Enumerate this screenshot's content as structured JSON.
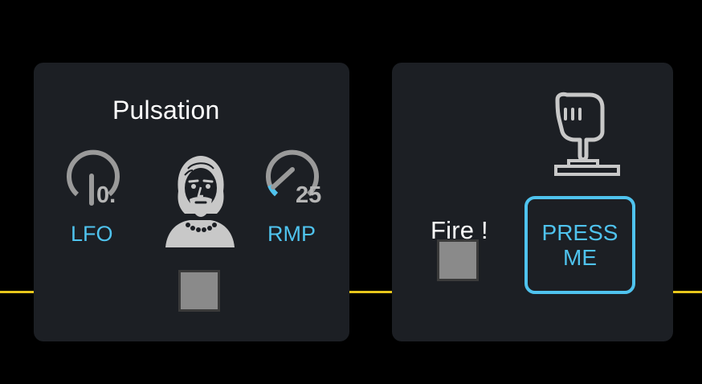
{
  "colors": {
    "background": "#000000",
    "panel": "#1c1f24",
    "accent": "#4fc3ee",
    "wire": "#e7c61b",
    "knob_track": "#9a9a9a",
    "toggle": "#8a8a8a"
  },
  "pulsation": {
    "title": "Pulsation",
    "lfo": {
      "label": "LFO",
      "value_text": "0.",
      "value": 0,
      "icon": "knob-dial-icon"
    },
    "rmp": {
      "label": "RMP",
      "value_text": "25",
      "value": 0.25,
      "icon": "knob-dial-icon"
    },
    "avatar_icon": "bearded-man-portrait-icon",
    "toggle_state": "off"
  },
  "fire": {
    "title": "Fire !",
    "hand_icon": "pointing-hand-button-icon",
    "button_label": "PRESS\nME",
    "toggle_state": "off"
  }
}
